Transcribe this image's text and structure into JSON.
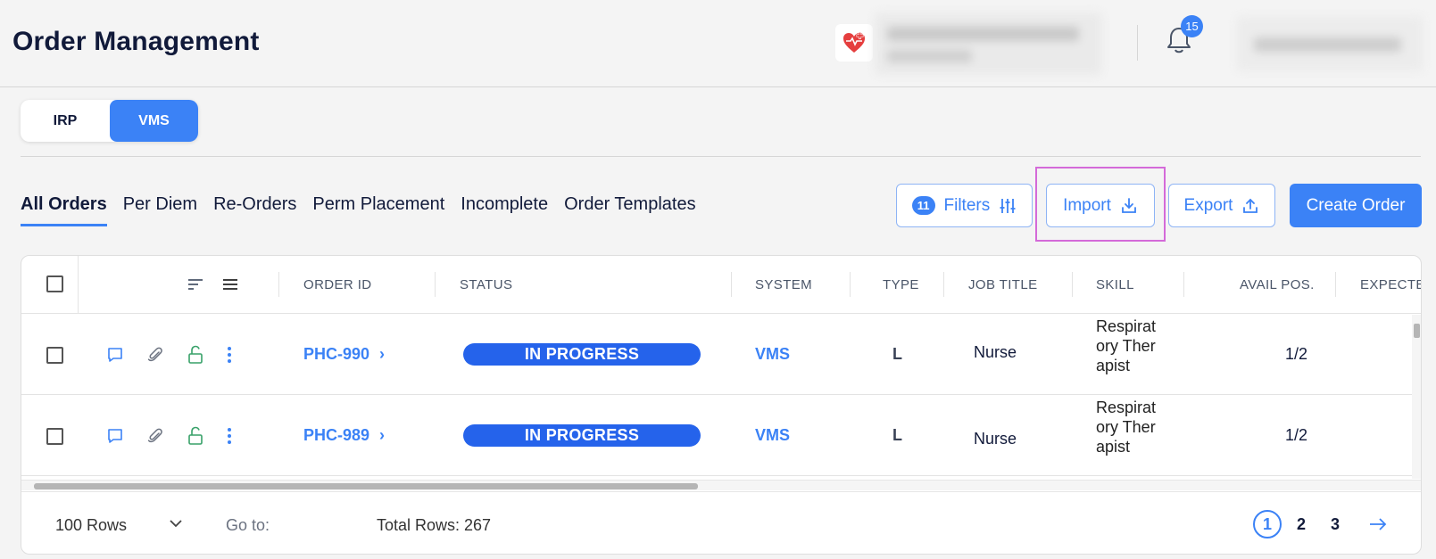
{
  "header": {
    "title": "Order Management",
    "notification_count": "15"
  },
  "system_switch": {
    "options": [
      "IRP",
      "VMS"
    ],
    "active": "VMS"
  },
  "tabs": [
    "All Orders",
    "Per Diem",
    "Re-Orders",
    "Perm Placement",
    "Incomplete",
    "Order Templates"
  ],
  "toolbar": {
    "filters_count": "11",
    "filters_label": "Filters",
    "import_label": "Import",
    "export_label": "Export",
    "create_label": "Create Order"
  },
  "table": {
    "columns": [
      "ORDER ID",
      "STATUS",
      "SYSTEM",
      "TYPE",
      "JOB TITLE",
      "SKILL",
      "AVAIL POS.",
      "EXPECTE"
    ],
    "rows": [
      {
        "order_id": "PHC-990",
        "status": "IN PROGRESS",
        "system": "VMS",
        "type": "L",
        "job_title": "Nurse",
        "skill": "Respiratory Therapist",
        "avail_pos": "1/2"
      },
      {
        "order_id": "PHC-989",
        "status": "IN PROGRESS",
        "system": "VMS",
        "type": "L",
        "job_title": "Nurse",
        "skill": "Respiratory Therapist",
        "avail_pos": "1/2"
      }
    ]
  },
  "footer": {
    "rows_per_page": "100 Rows",
    "goto_label": "Go to:",
    "total_rows": "Total Rows: 267",
    "pages": [
      "1",
      "2",
      "3"
    ],
    "current_page": "1"
  },
  "colors": {
    "accent": "#3b82f6",
    "status_in_progress": "#2563eb",
    "highlight": "#d46ad9"
  }
}
